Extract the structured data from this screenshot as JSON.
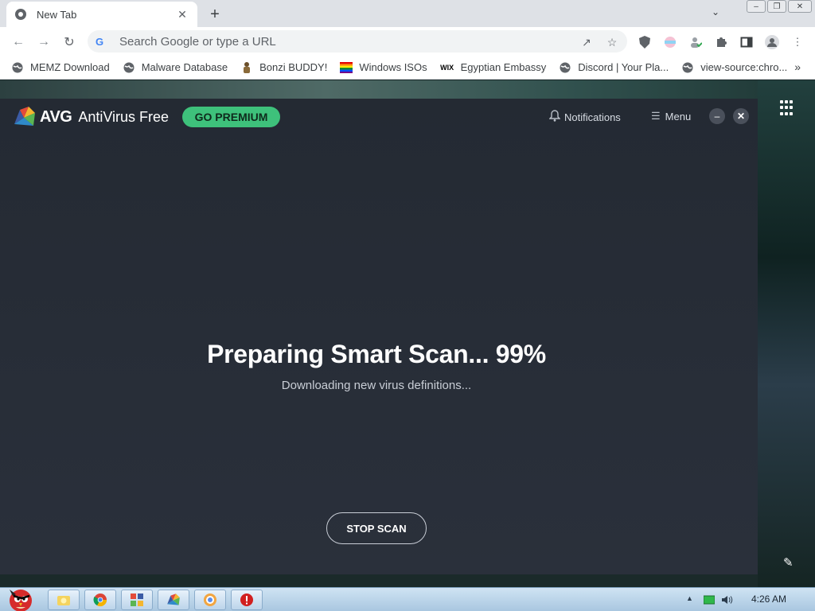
{
  "browser": {
    "tab_title": "New Tab",
    "tab_close": "✕",
    "new_tab": "+",
    "omnibox_placeholder": "Search Google or type a URL",
    "google_glyph": "G"
  },
  "bookmarks": [
    {
      "label": "MEMZ Download",
      "icon": "globe-icon"
    },
    {
      "label": "Malware Database",
      "icon": "globe-icon"
    },
    {
      "label": "Bonzi BUDDY!",
      "icon": "bonzi-icon"
    },
    {
      "label": "Windows ISOs",
      "icon": "rainbow-flag-icon"
    },
    {
      "label": "Egyptian Embassy",
      "icon": "wix-icon"
    },
    {
      "label": "Discord | Your Pla...",
      "icon": "globe-icon"
    },
    {
      "label": "view-source:chro...",
      "icon": "globe-icon"
    }
  ],
  "bookmark_icons": {
    "wix": "WIX"
  },
  "avg": {
    "brand": "AVG",
    "product": "AntiVirus Free",
    "premium_label": "GO PREMIUM",
    "notifications_label": "Notifications",
    "menu_label": "Menu",
    "scan_title": "Preparing Smart Scan... 99%",
    "scan_progress_percent": 99,
    "scan_subtitle": "Downloading new virus definitions...",
    "stop_label": "STOP SCAN"
  },
  "taskbar": {
    "clock": "4:26 AM"
  },
  "colors": {
    "premium_green": "#3ec17b",
    "avg_background": "#262c36"
  }
}
